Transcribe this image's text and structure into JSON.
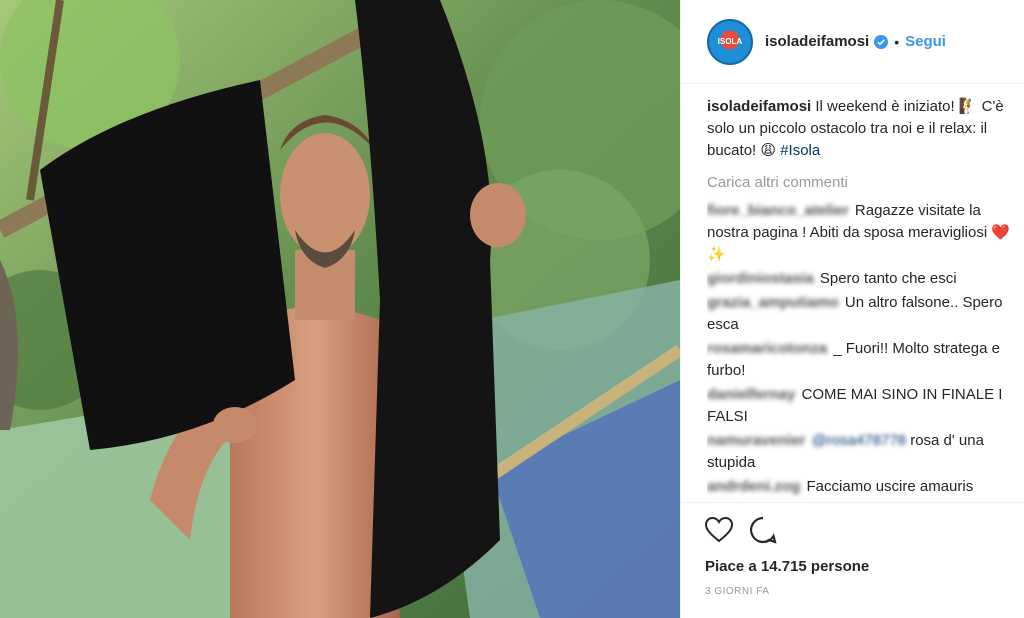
{
  "post": {
    "username": "isoladeifamosi",
    "separator": "•",
    "follow_label": "Segui",
    "avatar_text": "ISOLA",
    "caption": {
      "username": "isoladeifamosi",
      "text_1": "Il weekend è iniziato! 🧗 C'è solo un piccolo ostacolo tra noi e il relax: il bucato! 😩 ",
      "hashtag": "#Isola"
    },
    "load_more": "Carica altri commenti",
    "comments": [
      {
        "user": "fiore_bianco_atelier",
        "text": "Ragazze visitate la nostra pagina ! Abiti da sposa meravigliosi ❤️ ✨"
      },
      {
        "user": "giordiniostasia",
        "text": "Spero tanto che esci"
      },
      {
        "user": "grazia_amputiamo",
        "text": "Un altro falsone.. Spero esca"
      },
      {
        "user": "rosamaricotonza",
        "text": "_ Fuori!! Molto stratega e furbo!"
      },
      {
        "user": "danielfernay",
        "text": "COME MAI SINO IN FINALE I FALSI"
      },
      {
        "user": "namuravenier",
        "mention": "@rosa478778",
        "text": "rosa d' una stupida"
      },
      {
        "user": "andrdeni.zog",
        "text": "Facciamo uscire amauris"
      }
    ],
    "likes": "Piace a 14.715 persone",
    "time": "3 GIORNI FA",
    "accent": "#3897f0"
  }
}
